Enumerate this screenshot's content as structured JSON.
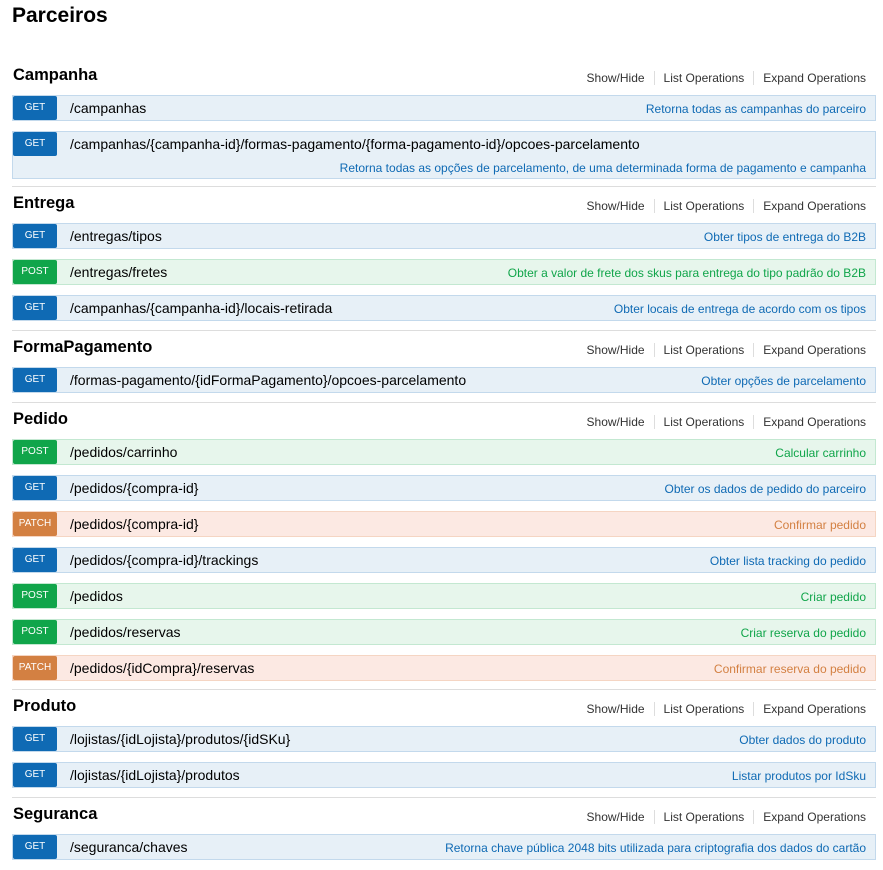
{
  "page_title": "Parceiros",
  "actions": {
    "show_hide": "Show/Hide",
    "list_ops": "List Operations",
    "expand_ops": "Expand Operations"
  },
  "resources": [
    {
      "title": "Campanha",
      "ops": [
        {
          "method": "GET",
          "path": "/campanhas",
          "summary": "Retorna todas as campanhas do parceiro"
        },
        {
          "method": "GET",
          "path": "/campanhas/{campanha-id}/formas-pagamento/{forma-pagamento-id}/opcoes-parcelamento",
          "summary": "Retorna todas as opções de parcelamento, de uma determinada forma de pagamento e campanha"
        }
      ]
    },
    {
      "title": "Entrega",
      "ops": [
        {
          "method": "GET",
          "path": "/entregas/tipos",
          "summary": "Obter tipos de entrega do B2B"
        },
        {
          "method": "POST",
          "path": "/entregas/fretes",
          "summary": "Obter a valor de frete dos skus para entrega do tipo padrão do B2B"
        },
        {
          "method": "GET",
          "path": "/campanhas/{campanha-id}/locais-retirada",
          "summary": "Obter locais de entrega de acordo com os tipos"
        }
      ]
    },
    {
      "title": "FormaPagamento",
      "ops": [
        {
          "method": "GET",
          "path": "/formas-pagamento/{idFormaPagamento}/opcoes-parcelamento",
          "summary": "Obter opções de parcelamento"
        }
      ]
    },
    {
      "title": "Pedido",
      "ops": [
        {
          "method": "POST",
          "path": "/pedidos/carrinho",
          "summary": "Calcular carrinho"
        },
        {
          "method": "GET",
          "path": "/pedidos/{compra-id}",
          "summary": "Obter os dados de pedido do parceiro"
        },
        {
          "method": "PATCH",
          "path": "/pedidos/{compra-id}",
          "summary": "Confirmar pedido"
        },
        {
          "method": "GET",
          "path": "/pedidos/{compra-id}/trackings",
          "summary": "Obter lista tracking do pedido"
        },
        {
          "method": "POST",
          "path": "/pedidos",
          "summary": "Criar pedido"
        },
        {
          "method": "POST",
          "path": "/pedidos/reservas",
          "summary": "Criar reserva do pedido"
        },
        {
          "method": "PATCH",
          "path": "/pedidos/{idCompra}/reservas",
          "summary": "Confirmar reserva do pedido"
        }
      ]
    },
    {
      "title": "Produto",
      "ops": [
        {
          "method": "GET",
          "path": "/lojistas/{idLojista}/produtos/{idSKu}",
          "summary": "Obter dados do produto"
        },
        {
          "method": "GET",
          "path": "/lojistas/{idLojista}/produtos",
          "summary": "Listar produtos por IdSku"
        }
      ]
    },
    {
      "title": "Seguranca",
      "ops": [
        {
          "method": "GET",
          "path": "/seguranca/chaves",
          "summary": "Retorna chave pública 2048 bits utilizada para criptografia dos dados do cartão"
        }
      ]
    }
  ]
}
